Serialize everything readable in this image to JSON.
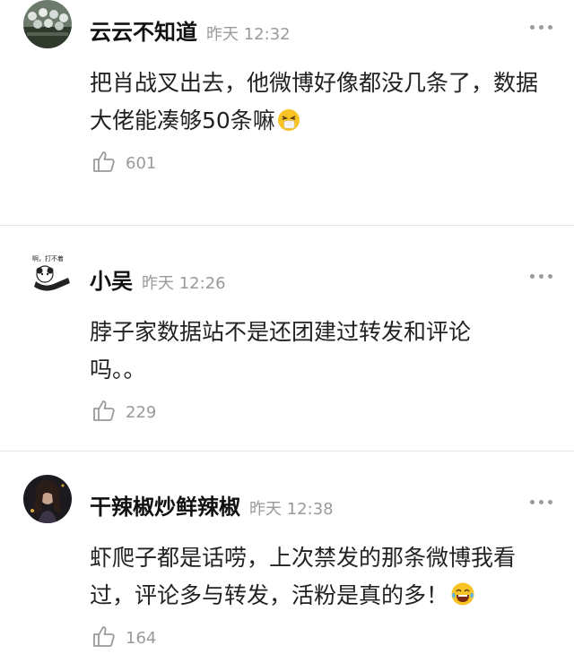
{
  "comments": [
    {
      "username": "云云不知道",
      "time": "昨天 12:32",
      "content": "把肖战叉出去，他微博好像都没几条了，数据大佬能凑够50条嘛",
      "emoji": "sneeze-emoji",
      "likes": "601"
    },
    {
      "username": "小吴",
      "time": "昨天 12:26",
      "content": "脖子家数据站不是还团建过转发和评论吗。。",
      "emoji": "",
      "likes": "229",
      "avatar_text": "啊，打不着"
    },
    {
      "username": "干辣椒炒鲜辣椒",
      "time": "昨天 12:38",
      "content": "虾爬子都是话唠，上次禁发的那条微博我看过，评论多与转发，活粉是真的多！",
      "emoji": "laughing-tears-emoji",
      "likes": "164"
    }
  ],
  "colors": {
    "muted": "#9a9a9a",
    "divider": "#e6e6e6",
    "emoji_yellow": "#f7c325"
  }
}
